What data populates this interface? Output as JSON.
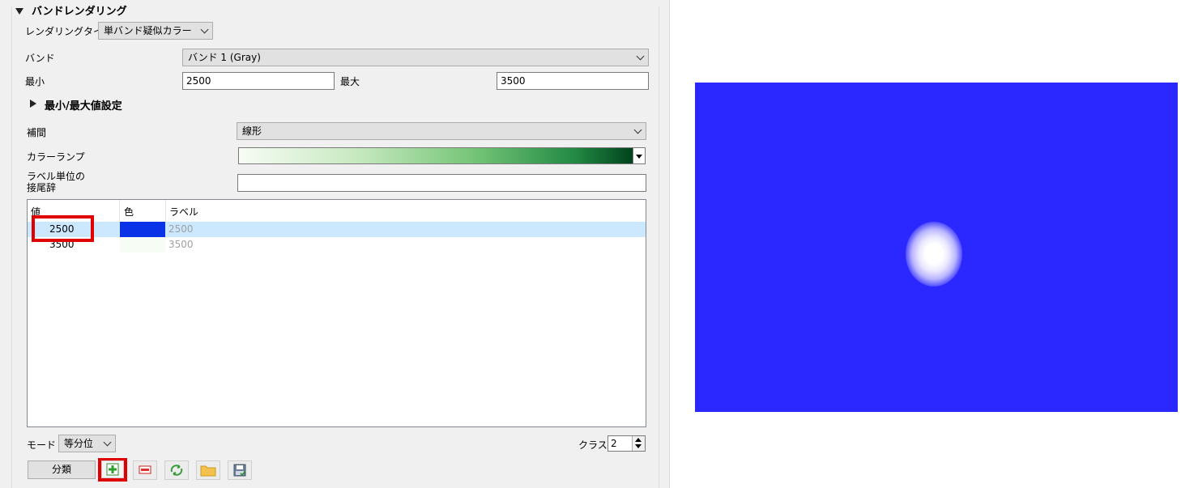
{
  "section": {
    "title": "バンドレンダリング"
  },
  "render_type": {
    "label": "レンダリングタイプ",
    "value": "単バンド疑似カラー"
  },
  "band": {
    "label": "バンド",
    "value": "バンド 1 (Gray)"
  },
  "min": {
    "label": "最小",
    "value": "2500"
  },
  "max": {
    "label": "最大",
    "value": "3500"
  },
  "minmax_settings": {
    "label": "最小/最大値設定"
  },
  "interpolation": {
    "label": "補間",
    "value": "線形"
  },
  "color_ramp": {
    "label": "カラーランプ",
    "colors": [
      "#f7fcf5",
      "#c7e9c0",
      "#74c476",
      "#238b45",
      "#00441b"
    ]
  },
  "label_suffix": {
    "label_line1": "ラベル単位の",
    "label_line2": "接尾辞",
    "value": ""
  },
  "table": {
    "headers": {
      "value": "値",
      "color": "色",
      "label": "ラベル"
    },
    "rows": [
      {
        "value": "2500",
        "color": "#0a32e6",
        "label": "2500",
        "selected": true
      },
      {
        "value": "3500",
        "color": "#f7fcf5",
        "label": "3500",
        "selected": false
      }
    ]
  },
  "mode": {
    "label": "モード",
    "value": "等分位"
  },
  "classes": {
    "label": "クラス",
    "value": "2"
  },
  "buttons": {
    "classify": "分類",
    "add": "add-icon",
    "remove": "remove-icon",
    "reverse": "reverse-icon",
    "load": "folder-icon",
    "save": "save-icon"
  },
  "map": {
    "background": "#2b28ff",
    "highlight": "#ffffff"
  }
}
